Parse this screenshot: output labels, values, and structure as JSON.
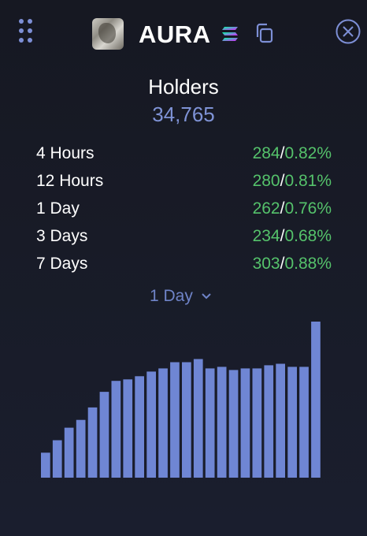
{
  "header": {
    "token_name": "AURA",
    "menu_icon": "dots-grid-icon",
    "chain_icon": "solana-icon",
    "copy_icon": "copy-icon",
    "close_icon": "close-circle-icon"
  },
  "holders": {
    "title": "Holders",
    "count": "34,765"
  },
  "changes": [
    {
      "label": "4 Hours",
      "count": "284",
      "percent": "0.82%"
    },
    {
      "label": "12 Hours",
      "count": "280",
      "percent": "0.81%"
    },
    {
      "label": "1 Day",
      "count": "262",
      "percent": "0.76%"
    },
    {
      "label": "3 Days",
      "count": "234",
      "percent": "0.68%"
    },
    {
      "label": "7 Days",
      "count": "303",
      "percent": "0.88%"
    }
  ],
  "period_select": {
    "selected": "1 Day"
  },
  "colors": {
    "accent": "#7f93d6",
    "bar": "#6f86d4",
    "positive": "#55c26b",
    "background": "#171a25"
  },
  "chart_data": {
    "type": "bar",
    "series": [
      {
        "values": [
          16,
          24,
          32,
          37,
          45,
          55,
          62,
          63,
          65,
          68,
          70,
          74,
          74,
          76,
          70,
          71,
          69,
          70,
          70,
          72,
          73,
          71,
          71,
          100
        ]
      }
    ],
    "ylim": [
      0,
      100
    ],
    "grid": false
  }
}
